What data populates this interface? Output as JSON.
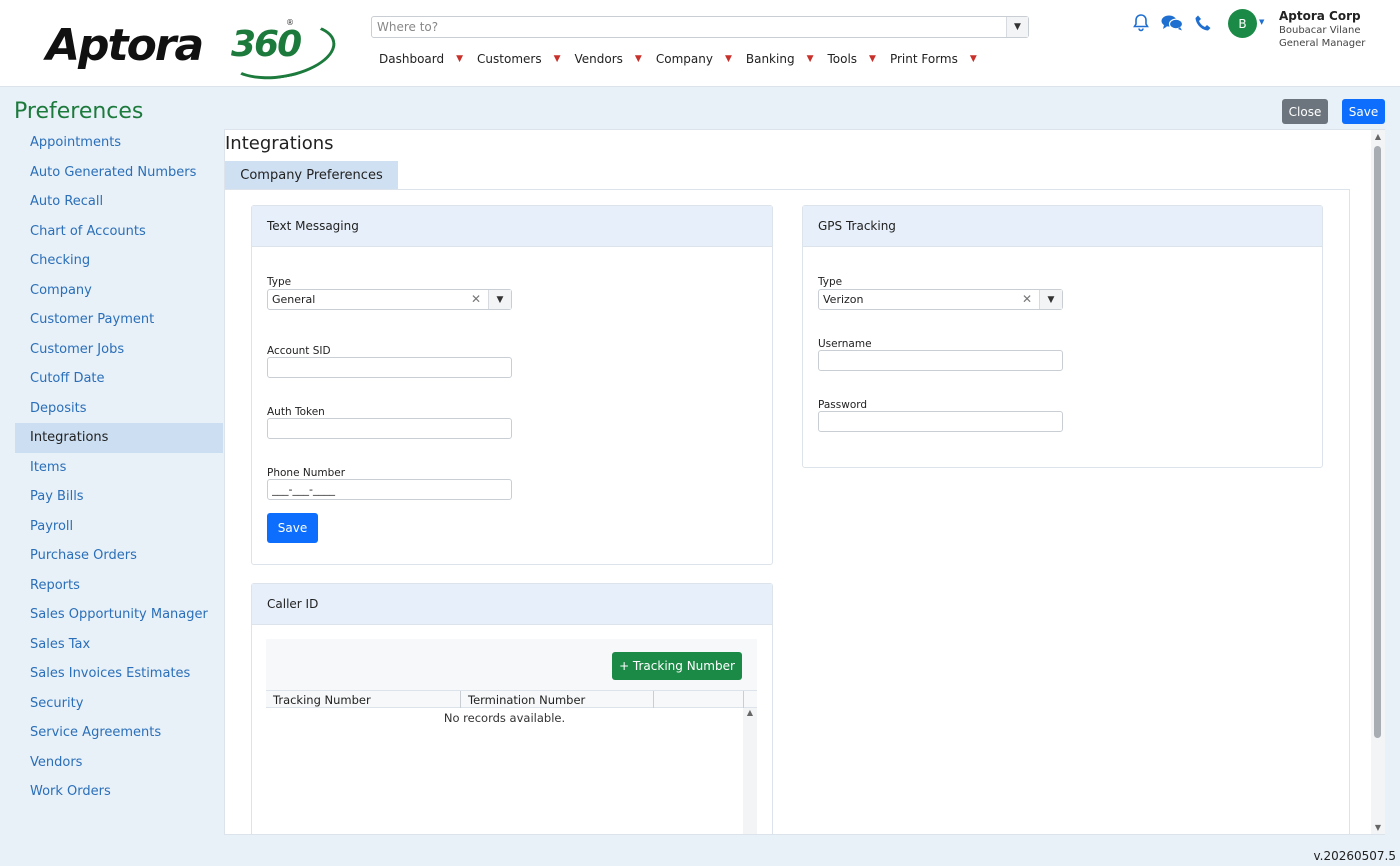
{
  "brand": {
    "name": "Aptora",
    "suffix": "360",
    "reg": "®"
  },
  "search": {
    "placeholder": "Where to?"
  },
  "nav": [
    {
      "label": "Dashboard"
    },
    {
      "label": "Customers"
    },
    {
      "label": "Vendors"
    },
    {
      "label": "Company"
    },
    {
      "label": "Banking"
    },
    {
      "label": "Tools"
    },
    {
      "label": "Print Forms"
    }
  ],
  "user": {
    "initial": "B",
    "company": "Aptora Corp",
    "name": "Boubacar Vilane",
    "role": "General Manager"
  },
  "page": {
    "title": "Preferences",
    "close_label": "Close",
    "save_label": "Save"
  },
  "sidebar": {
    "items": [
      {
        "label": "Appointments"
      },
      {
        "label": "Auto Generated Numbers"
      },
      {
        "label": "Auto Recall"
      },
      {
        "label": "Chart of Accounts"
      },
      {
        "label": "Checking"
      },
      {
        "label": "Company"
      },
      {
        "label": "Customer Payment"
      },
      {
        "label": "Customer Jobs"
      },
      {
        "label": "Cutoff Date"
      },
      {
        "label": "Deposits"
      },
      {
        "label": "Integrations"
      },
      {
        "label": "Items"
      },
      {
        "label": "Pay Bills"
      },
      {
        "label": "Payroll"
      },
      {
        "label": "Purchase Orders"
      },
      {
        "label": "Reports"
      },
      {
        "label": "Sales Opportunity Manager"
      },
      {
        "label": "Sales Tax"
      },
      {
        "label": "Sales Invoices Estimates"
      },
      {
        "label": "Security"
      },
      {
        "label": "Service Agreements"
      },
      {
        "label": "Vendors"
      },
      {
        "label": "Work Orders"
      }
    ],
    "active": "Integrations"
  },
  "content": {
    "title": "Integrations",
    "tab": "Company Preferences",
    "text_messaging": {
      "title": "Text Messaging",
      "type_label": "Type",
      "type_value": "General",
      "account_sid_label": "Account SID",
      "account_sid_value": "",
      "auth_token_label": "Auth Token",
      "auth_token_value": "",
      "phone_label": "Phone Number",
      "phone_value": "___-___-____",
      "save_label": "Save"
    },
    "gps": {
      "title": "GPS Tracking",
      "type_label": "Type",
      "type_value": "Verizon",
      "username_label": "Username",
      "username_value": "",
      "password_label": "Password",
      "password_value": ""
    },
    "caller_id": {
      "title": "Caller ID",
      "add_label": "+ Tracking Number",
      "columns": [
        "Tracking Number",
        "Termination Number",
        ""
      ],
      "empty_text": "No records available."
    }
  },
  "version": "v.20260507.5",
  "colors": {
    "brand_green": "#1c7a3c",
    "primary": "#0d6efd",
    "link": "#2a6fb8",
    "active_bg": "#ccdff2"
  },
  "icons": [
    "bell-icon",
    "chat-icon",
    "phone-icon",
    "caret-down-icon",
    "clear-icon"
  ]
}
